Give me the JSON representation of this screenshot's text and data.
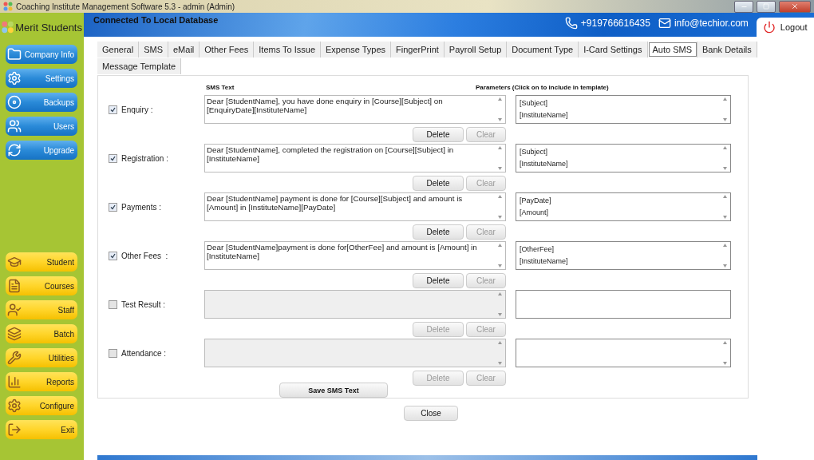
{
  "window": {
    "title": "Coaching Institute Management Software 5.3  -  admin (Admin)"
  },
  "sidebar": {
    "brand": "Merit Students",
    "admin_items": [
      {
        "label": "Company Info"
      },
      {
        "label": "Settings"
      },
      {
        "label": "Backups"
      },
      {
        "label": "Users"
      },
      {
        "label": "Upgrade"
      }
    ],
    "main_items": [
      {
        "label": "Student"
      },
      {
        "label": "Courses"
      },
      {
        "label": "Staff"
      },
      {
        "label": "Batch"
      },
      {
        "label": "Utilities"
      },
      {
        "label": "Reports"
      },
      {
        "label": "Configure"
      },
      {
        "label": "Exit"
      }
    ]
  },
  "header": {
    "status": "Connected To  Local Database",
    "phone": "+919766616435",
    "email": "info@techior.com",
    "logout": "Logout"
  },
  "tab_rows": [
    {
      "tabs": [
        {
          "label": "General",
          "selected": false
        },
        {
          "label": "SMS",
          "selected": false
        },
        {
          "label": "eMail",
          "selected": false
        },
        {
          "label": "Other Fees",
          "selected": false
        },
        {
          "label": "Items To Issue",
          "selected": false
        },
        {
          "label": "Expense Types",
          "selected": false
        },
        {
          "label": "FingerPrint",
          "selected": false
        },
        {
          "label": "Payroll Setup",
          "selected": false
        },
        {
          "label": "Document Type",
          "selected": false
        },
        {
          "label": "I-Card Settings",
          "selected": false
        },
        {
          "label": "Auto SMS",
          "selected": true
        },
        {
          "label": "Bank Details",
          "selected": false
        }
      ]
    },
    {
      "tabs": [
        {
          "label": "Message Template",
          "selected": false
        }
      ]
    }
  ],
  "sms_panel": {
    "text_heading": "SMS Text",
    "params_heading": "Parameters (Click on to include in template)",
    "rows": [
      {
        "label": "Enquiry :",
        "checked": true,
        "text": "Dear [StudentName], you have done enquiry in [Course][Subject] on [EnquiryDate][InstituteName]",
        "text_disabled": false,
        "params": [
          "[Subject]",
          "[InstituteName]"
        ],
        "params_scrollbar": true,
        "delete_label": "Delete",
        "delete_disabled": false,
        "clear_label": "Clear",
        "clear_disabled": true
      },
      {
        "label": "Registration :",
        "checked": true,
        "text": "Dear [StudentName], completed the registration on [Course][Subject] in [InstituteName]",
        "text_disabled": false,
        "params": [
          "[Subject]",
          "[InstituteName]"
        ],
        "params_scrollbar": true,
        "delete_label": "Delete",
        "delete_disabled": false,
        "clear_label": "Clear",
        "clear_disabled": true
      },
      {
        "label": "Payments :",
        "checked": true,
        "text": "Dear [StudentName] payment is done for [Course][Subject] and amount is [Amount] in [InstituteName][PayDate]",
        "text_disabled": false,
        "params": [
          "[PayDate]",
          "[Amount]"
        ],
        "params_scrollbar": true,
        "delete_label": "Delete",
        "delete_disabled": false,
        "clear_label": "Clear",
        "clear_disabled": true
      },
      {
        "label": "Other Fees  :",
        "checked": true,
        "text": "Dear [StudentName]payment is done for[OtherFee] and amount is [Amount] in [InstituteName]",
        "text_disabled": false,
        "params": [
          "[OtherFee]",
          "[InstituteName]"
        ],
        "params_scrollbar": true,
        "delete_label": "Delete",
        "delete_disabled": false,
        "clear_label": "Clear",
        "clear_disabled": true
      },
      {
        "label": "Test Result :",
        "checked": false,
        "text_disabled": true,
        "params_scrollbar": false,
        "delete_label": "Delete",
        "delete_disabled": true,
        "clear_label": "Clear",
        "clear_disabled": true
      },
      {
        "label": "Attendance :",
        "checked": false,
        "text_disabled": true,
        "params_scrollbar": true,
        "delete_label": "Delete",
        "delete_disabled": true,
        "clear_label": "Clear",
        "clear_disabled": true
      }
    ],
    "save_button": "Save SMS Text"
  },
  "close_button": "Close"
}
